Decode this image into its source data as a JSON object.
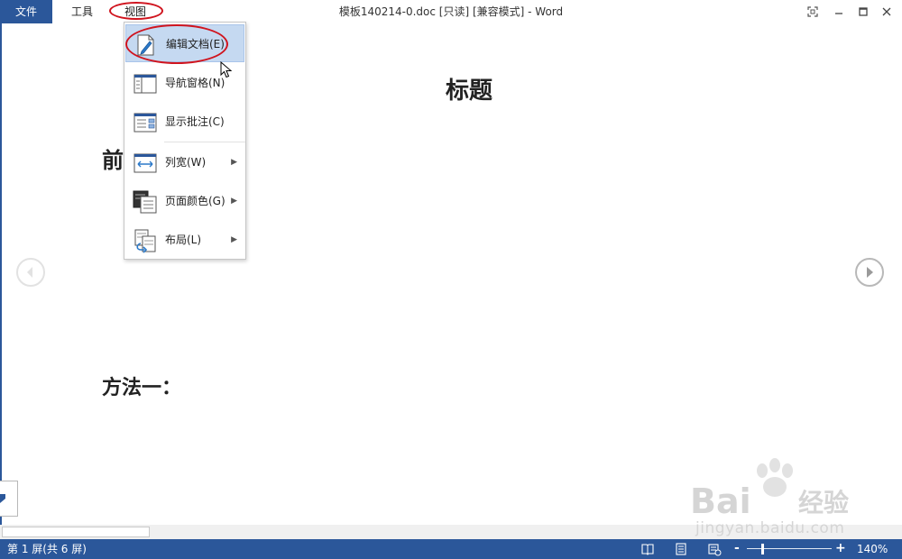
{
  "menubar": {
    "tabs": [
      {
        "label": "文件"
      },
      {
        "label": "工具"
      },
      {
        "label": "视图"
      }
    ]
  },
  "window": {
    "title": "模板140214-0.doc [只读] [兼容模式] - Word"
  },
  "document": {
    "heading": "标题",
    "section_1": "前",
    "section_2": "方法一："
  },
  "view_menu": {
    "items": [
      {
        "label": "编辑文档(E)",
        "icon": "edit-document-icon",
        "highlighted": true
      },
      {
        "label": "导航窗格(N)",
        "icon": "navigation-pane-icon"
      },
      {
        "label": "显示批注(C)",
        "icon": "show-comments-icon"
      },
      {
        "label": "列宽(W)",
        "icon": "column-width-icon",
        "submenu": true
      },
      {
        "label": "页面颜色(G)",
        "icon": "page-color-icon",
        "submenu": true
      },
      {
        "label": "布局(L)",
        "icon": "layout-icon",
        "submenu": true
      }
    ]
  },
  "statusbar": {
    "page_info": "第 1 屏(共 6 屏)",
    "zoom_level": "140%",
    "zoom_minus": "-",
    "zoom_plus": "+",
    "zoom_fraction": 0.18
  },
  "watermark": {
    "brand": "Bai",
    "brand_cn": "经验",
    "url": "jingyan.baidu.com"
  },
  "colors": {
    "accent": "#2b579a",
    "highlight": "#c5d9f1",
    "annotation_red": "#d0141e"
  }
}
